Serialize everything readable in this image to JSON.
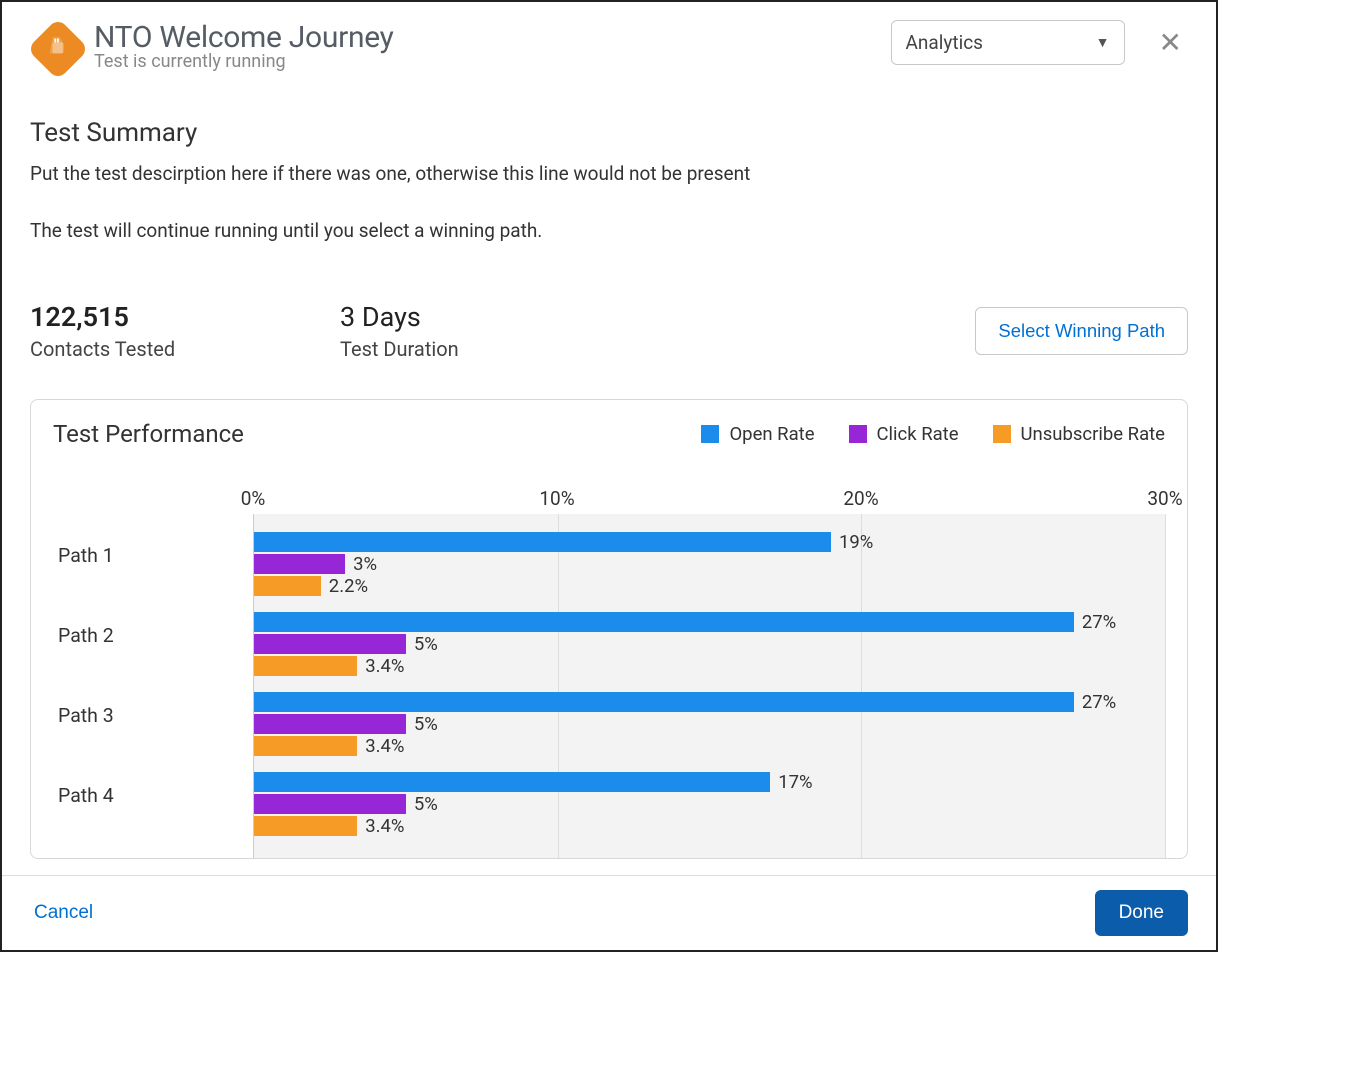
{
  "header": {
    "title": "NTO Welcome Journey",
    "subtitle": "Test is currently running",
    "dropdown_selected": "Analytics"
  },
  "summary": {
    "heading": "Test Summary",
    "description": "Put the test descirption here if there was one, otherwise this line would not be present",
    "status_line": "The test will continue running until you select a winning path."
  },
  "metrics": {
    "contacts_tested_value": "122,515",
    "contacts_tested_label": "Contacts Tested",
    "duration_value": "3 Days",
    "duration_label": "Test Duration",
    "select_winning_path_label": "Select Winning Path"
  },
  "performance": {
    "heading": "Test Performance",
    "legend": {
      "open": "Open Rate",
      "click": "Click Rate",
      "unsub": "Unsubscribe Rate"
    },
    "axis_ticks": [
      "0%",
      "10%",
      "20%",
      "30%"
    ]
  },
  "footer": {
    "cancel": "Cancel",
    "done": "Done"
  },
  "chart_data": {
    "type": "bar",
    "orientation": "horizontal",
    "xlabel": "",
    "ylabel": "",
    "xlim": [
      0,
      30
    ],
    "x_ticks": [
      0,
      10,
      20,
      30
    ],
    "x_tick_labels": [
      "0%",
      "10%",
      "20%",
      "30%"
    ],
    "categories": [
      "Path 1",
      "Path 2",
      "Path 3",
      "Path 4"
    ],
    "series": [
      {
        "name": "Open Rate",
        "color": "#1b8ceb",
        "values": [
          19,
          27,
          27,
          17
        ],
        "labels": [
          "19%",
          "27%",
          "27%",
          "17%"
        ]
      },
      {
        "name": "Click Rate",
        "color": "#9626d6",
        "values": [
          3,
          5,
          5,
          5
        ],
        "labels": [
          "3%",
          "5%",
          "5%",
          "5%"
        ]
      },
      {
        "name": "Unsubscribe Rate",
        "color": "#f59b26",
        "values": [
          2.2,
          3.4,
          3.4,
          3.4
        ],
        "labels": [
          "2.2%",
          "3.4%",
          "3.4%",
          "3.4%"
        ]
      }
    ],
    "legend_position": "top-right",
    "title": "Test Performance"
  }
}
